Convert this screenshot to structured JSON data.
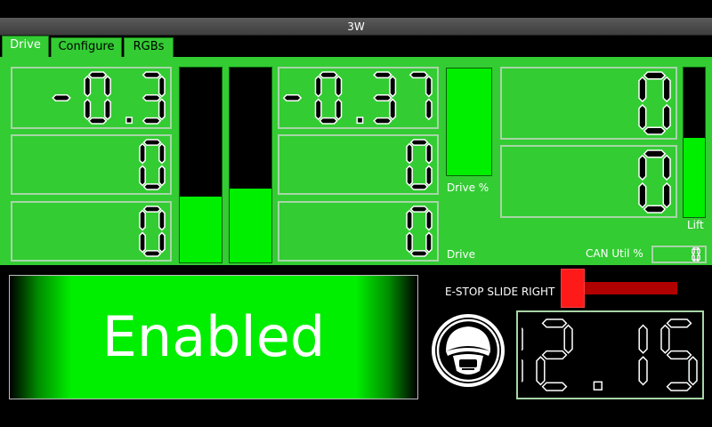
{
  "window": {
    "title": "3W"
  },
  "tabs": [
    {
      "label": "Drive",
      "active": true
    },
    {
      "label": "Configure",
      "active": false
    },
    {
      "label": "RGBs",
      "active": false
    }
  ],
  "drive_panel": {
    "left_column": [
      "-0.3",
      "0",
      "0"
    ],
    "middle_column": [
      "-0.37",
      "0",
      "0"
    ],
    "right_column": [
      "0",
      "0"
    ],
    "bars": {
      "left_bar_level": 0.34,
      "left_bar2_level": 0.38,
      "drive_pct_level": 1.0,
      "lift_level": 0.53
    },
    "labels": {
      "drive_pct": "Drive %",
      "drive": "Drive",
      "lift": "Lift",
      "can_util": "CAN Util %"
    },
    "can_util_value": "0"
  },
  "status": {
    "enabled_text": "Enabled",
    "estop_label": "E-STOP SLIDE RIGHT",
    "battery_voltage": "12.15"
  },
  "colors": {
    "panel_green": "#33cc33",
    "bar_fill": "#00ee00",
    "estop_red": "#ff1a1a"
  }
}
